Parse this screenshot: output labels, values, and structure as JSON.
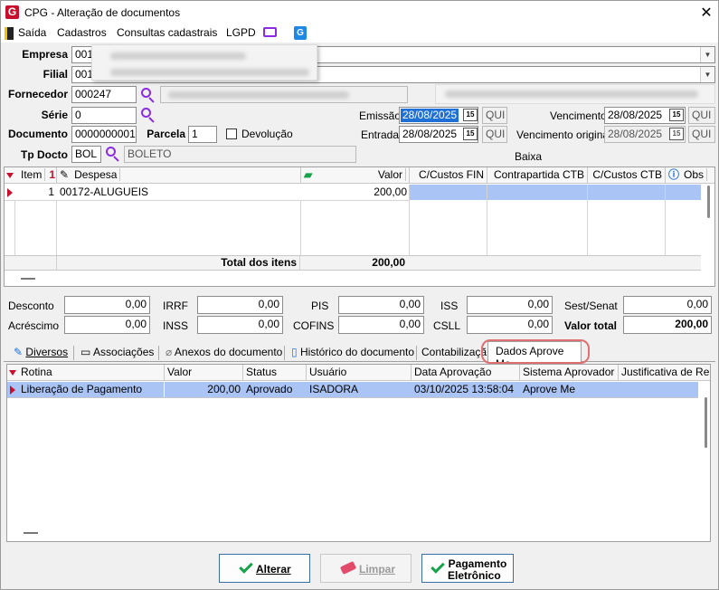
{
  "window": {
    "title": "CPG - Alteração de documentos",
    "logo_letter": "G",
    "close": "✕"
  },
  "menu": {
    "items": [
      "Saída",
      "Cadastros",
      "Consultas cadastrais",
      "LGPD"
    ]
  },
  "form": {
    "empresa_label": "Empresa",
    "empresa_value": "001",
    "filial_label": "Filial",
    "filial_value": "001",
    "fornecedor_label": "Fornecedor",
    "fornecedor_value": "000247",
    "serie_label": "Série",
    "serie_value": "0",
    "documento_label": "Documento",
    "documento_value": "0000000001",
    "parcela_label": "Parcela",
    "parcela_value": "1",
    "devolucao_label": "Devolução",
    "tpdocto_label": "Tp Docto",
    "tpdocto_code": "BOL",
    "tpdocto_name": "BOLETO",
    "emissao_label": "Emissão",
    "emissao_value": "28/08/2025",
    "emissao_day": "QUI",
    "entrada_label": "Entrada",
    "entrada_value": "28/08/2025",
    "entrada_day": "QUI",
    "vencimento_label": "Vencimento",
    "vencimento_value": "28/08/2025",
    "vencimento_day": "QUI",
    "venc_original_label": "Vencimento original",
    "venc_original_value": "28/08/2025",
    "venc_original_day": "QUI",
    "baixa_label": "Baixa",
    "cal_label": "15"
  },
  "items_grid": {
    "headers": [
      "Item",
      "Despesa",
      "Valor",
      "C/Custos FIN",
      "Contrapartida CTB",
      "C/Custos CTB",
      "Obs"
    ],
    "row": {
      "item": "1",
      "despesa": "00172-ALUGUEIS",
      "valor": "200,00"
    },
    "total_label": "Total dos itens",
    "total_value": "200,00"
  },
  "taxes": {
    "desconto_label": "Desconto",
    "desconto": "0,00",
    "acrescimo_label": "Acréscimo",
    "acrescimo": "0,00",
    "irrf_label": "IRRF",
    "irrf": "0,00",
    "inss_label": "INSS",
    "inss": "0,00",
    "pis_label": "PIS",
    "pis": "0,00",
    "cofins_label": "COFINS",
    "cofins": "0,00",
    "iss_label": "ISS",
    "iss": "0,00",
    "csll_label": "CSLL",
    "csll": "0,00",
    "sest_label": "Sest/Senat",
    "sest": "0,00",
    "valor_total_label": "Valor total",
    "valor_total": "200,00"
  },
  "tabs": [
    "Diversos",
    "Associações",
    "Anexos do documento",
    "Histórico do documento",
    "Contabilizaçã",
    "Dados Aprove Me"
  ],
  "approval_grid": {
    "headers": [
      "Rotina",
      "Valor",
      "Status",
      "Usuário",
      "Data Aprovação",
      "Sistema Aprovador",
      "Justificativa de Re"
    ],
    "row": {
      "rotina": "Liberação de Pagamento",
      "valor": "200,00",
      "status": "Aprovado",
      "usuario": "ISADORA",
      "data": "03/10/2025 13:58:04",
      "sistema": "Aprove Me",
      "justificativa": ""
    }
  },
  "buttons": {
    "alterar": "Alterar",
    "limpar": "Limpar",
    "pagamento_line1": "Pagamento",
    "pagamento_line2": "Eletrônico"
  },
  "colors": {
    "accent": "#c8102e",
    "selection": "#a9c4f5",
    "highlight_circle": "#e07070",
    "check": "#16a34a"
  }
}
